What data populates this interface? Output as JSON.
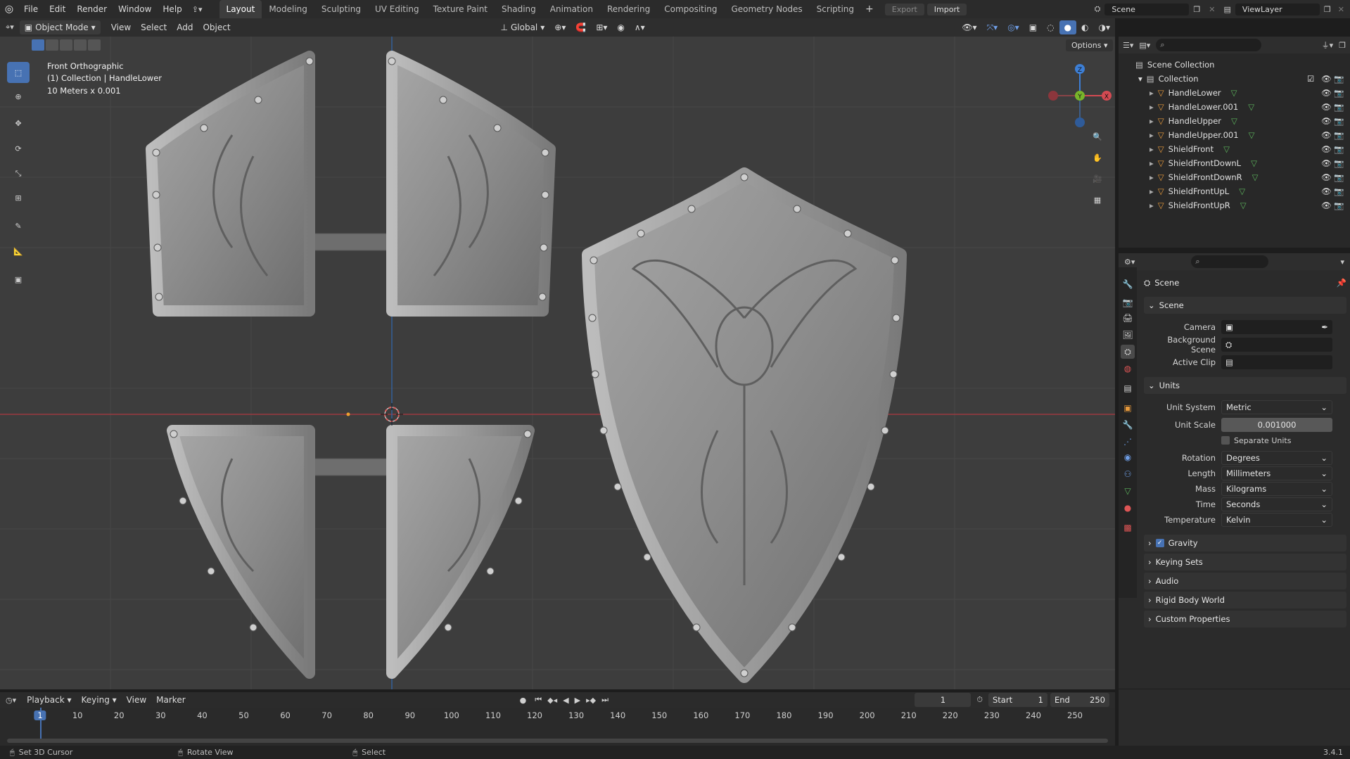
{
  "app": {
    "version": "3.4.1"
  },
  "menu": {
    "file": "File",
    "edit": "Edit",
    "render": "Render",
    "window": "Window",
    "help": "Help"
  },
  "workspaces": [
    "Layout",
    "Modeling",
    "Sculpting",
    "UV Editing",
    "Texture Paint",
    "Shading",
    "Animation",
    "Rendering",
    "Compositing",
    "Geometry Nodes",
    "Scripting"
  ],
  "topbar": {
    "export": "Export",
    "import": "Import",
    "scene": "Scene",
    "view_layer": "ViewLayer"
  },
  "viewport_header": {
    "mode": "Object Mode",
    "view": "View",
    "select": "Select",
    "add": "Add",
    "object": "Object",
    "orientation": "Global",
    "options": "Options"
  },
  "viewport_info": {
    "line1": "Front Orthographic",
    "line2": "(1) Collection | HandleLower",
    "line3": "10 Meters x 0.001"
  },
  "gizmo": {
    "x": "X",
    "y": "Y",
    "z": "Z"
  },
  "outliner": {
    "root": "Scene Collection",
    "collection": "Collection",
    "objects": [
      "HandleLower",
      "HandleLower.001",
      "HandleUpper",
      "HandleUpper.001",
      "ShieldFront",
      "ShieldFrontDownL",
      "ShieldFrontDownR",
      "ShieldFrontUpL",
      "ShieldFrontUpR"
    ]
  },
  "properties": {
    "context": "Scene",
    "scene_panel": {
      "title": "Scene",
      "camera_label": "Camera",
      "bg_label": "Background Scene",
      "clip_label": "Active Clip"
    },
    "units_panel": {
      "title": "Units",
      "unit_system_label": "Unit System",
      "unit_system": "Metric",
      "unit_scale_label": "Unit Scale",
      "unit_scale": "0.001000",
      "separate_units": "Separate Units",
      "rotation_label": "Rotation",
      "rotation": "Degrees",
      "length_label": "Length",
      "length": "Millimeters",
      "mass_label": "Mass",
      "mass": "Kilograms",
      "time_label": "Time",
      "time": "Seconds",
      "temperature_label": "Temperature",
      "temperature": "Kelvin"
    },
    "collapsed_panels": {
      "gravity": "Gravity",
      "keying_sets": "Keying Sets",
      "audio": "Audio",
      "rigid_body": "Rigid Body World",
      "custom": "Custom Properties"
    },
    "gravity_checked": true
  },
  "timeline": {
    "playback": "Playback",
    "keying": "Keying",
    "view": "View",
    "marker": "Marker",
    "current_frame": "1",
    "start_label": "Start",
    "start": "1",
    "end_label": "End",
    "end": "250",
    "ticks": [
      "1",
      "10",
      "20",
      "30",
      "40",
      "50",
      "60",
      "70",
      "80",
      "90",
      "100",
      "110",
      "120",
      "130",
      "140",
      "150",
      "160",
      "170",
      "180",
      "190",
      "200",
      "210",
      "220",
      "230",
      "240",
      "250"
    ]
  },
  "status": {
    "left": "Set 3D Cursor",
    "middle": "Rotate View",
    "right": "Select"
  },
  "colors": {
    "accent": "#4772b3",
    "x_axis": "#d44a52",
    "y_axis": "#78b52a",
    "z_axis": "#3d7fd6",
    "object_orange": "#e89a3c",
    "mesh_green": "#5cb35c"
  }
}
